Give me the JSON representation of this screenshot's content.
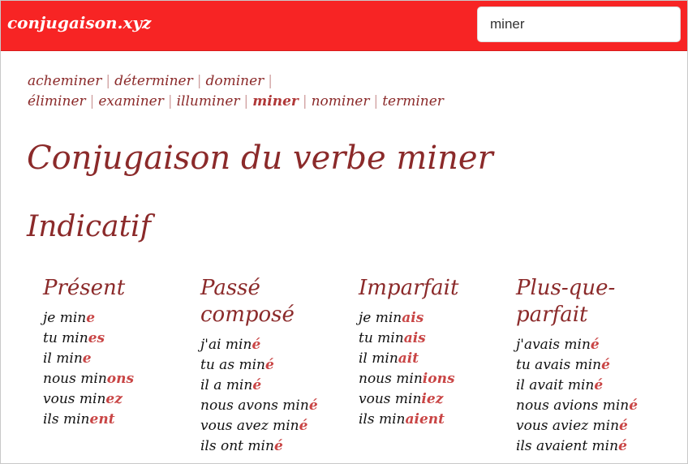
{
  "header": {
    "logo": "conjugaison.xyz",
    "search_value": "miner",
    "bg_color": "#f72424"
  },
  "related_verbs": [
    {
      "label": "acheminer",
      "current": false
    },
    {
      "label": "déterminer",
      "current": false
    },
    {
      "label": "dominer",
      "current": false
    },
    {
      "label": "éliminer",
      "current": false
    },
    {
      "label": "examiner",
      "current": false
    },
    {
      "label": "illuminer",
      "current": false
    },
    {
      "label": "miner",
      "current": true
    },
    {
      "label": "nominer",
      "current": false
    },
    {
      "label": "terminer",
      "current": false
    }
  ],
  "page_title": "Conjugaison du verbe miner",
  "mood": "Indicatif",
  "tenses": [
    {
      "name": "Présent",
      "forms": [
        {
          "stem": "je min",
          "end": "e"
        },
        {
          "stem": "tu min",
          "end": "es"
        },
        {
          "stem": "il min",
          "end": "e"
        },
        {
          "stem": "nous min",
          "end": "ons"
        },
        {
          "stem": "vous min",
          "end": "ez"
        },
        {
          "stem": "ils min",
          "end": "ent"
        }
      ]
    },
    {
      "name": "Passé composé",
      "forms": [
        {
          "stem": "j'ai min",
          "end": "é"
        },
        {
          "stem": "tu as min",
          "end": "é"
        },
        {
          "stem": "il a min",
          "end": "é"
        },
        {
          "stem": "nous avons min",
          "end": "é"
        },
        {
          "stem": "vous avez min",
          "end": "é"
        },
        {
          "stem": "ils ont min",
          "end": "é"
        }
      ]
    },
    {
      "name": "Imparfait",
      "forms": [
        {
          "stem": "je min",
          "end": "ais"
        },
        {
          "stem": "tu min",
          "end": "ais"
        },
        {
          "stem": "il min",
          "end": "ait"
        },
        {
          "stem": "nous min",
          "end": "ions"
        },
        {
          "stem": "vous min",
          "end": "iez"
        },
        {
          "stem": "ils min",
          "end": "aient"
        }
      ]
    },
    {
      "name": "Plus-que-parfait",
      "forms": [
        {
          "stem": "j'avais min",
          "end": "é"
        },
        {
          "stem": "tu avais min",
          "end": "é"
        },
        {
          "stem": "il avait min",
          "end": "é"
        },
        {
          "stem": "nous avions min",
          "end": "é"
        },
        {
          "stem": "vous aviez min",
          "end": "é"
        },
        {
          "stem": "ils avaient min",
          "end": "é"
        }
      ]
    }
  ]
}
